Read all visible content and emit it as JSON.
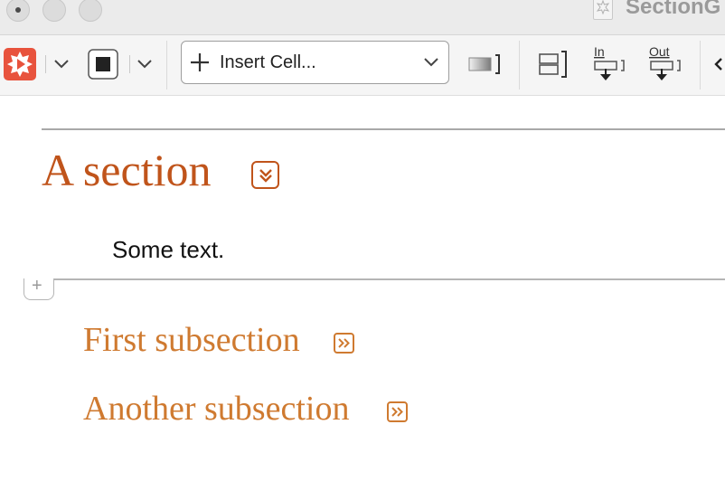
{
  "window": {
    "title": "SectionG"
  },
  "toolbar": {
    "insert_cell_label": "Insert Cell...",
    "in_label": "In",
    "out_label": "Out"
  },
  "notebook": {
    "section_title": "A section",
    "text": "Some text.",
    "add_cell_symbol": "+",
    "subsections": [
      {
        "title": "First subsection"
      },
      {
        "title": "Another subsection"
      }
    ]
  },
  "colors": {
    "section": "#c0541b",
    "subsection": "#cf7a30",
    "evaluate_icon": "#e8533d"
  }
}
